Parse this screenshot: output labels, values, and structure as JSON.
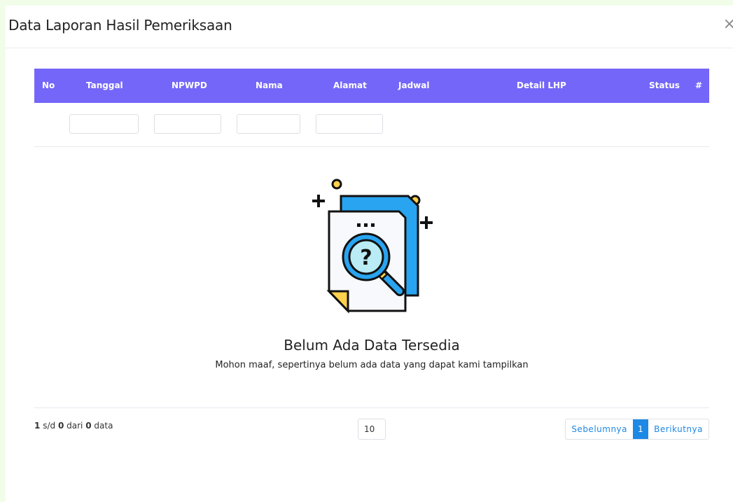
{
  "modal": {
    "title": "Data Laporan Hasil Pemeriksaan",
    "close_glyph": "×"
  },
  "table": {
    "headers": [
      "No",
      "Tanggal",
      "NPWPD",
      "Nama",
      "Alamat",
      "Jadwal",
      "Detail LHP",
      "Status",
      "#"
    ],
    "filters": [
      {
        "value": "",
        "placeholder": ""
      },
      {
        "value": "",
        "placeholder": ""
      },
      {
        "value": "",
        "placeholder": ""
      },
      {
        "value": "",
        "placeholder": ""
      }
    ],
    "header_bg": "#7466f8"
  },
  "empty_state": {
    "icon": "document-search-icon",
    "title": "Belum Ada Data Tersedia",
    "subtitle": "Mohon maaf, sepertinya belum ada data yang dapat kami tampilkan"
  },
  "footer": {
    "from": "1",
    "sd": "s/d",
    "to": "0",
    "dari": "dari",
    "total": "0",
    "data_word": "data",
    "page_size": "10",
    "prev_label": "Sebelumnya",
    "current_page": "1",
    "next_label": "Berikutnya",
    "accent": "#1e88e5"
  }
}
